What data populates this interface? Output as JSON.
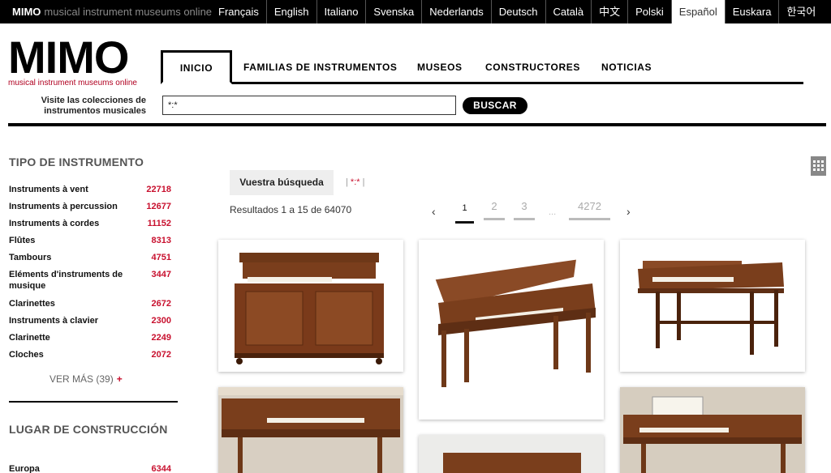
{
  "topbar": {
    "brand_short": "MIMO",
    "brand_long": "musical instrument museums online",
    "languages": [
      "Français",
      "English",
      "Italiano",
      "Svenska",
      "Nederlands",
      "Deutsch",
      "Català",
      "中文",
      "Polski",
      "Español",
      "Euskara",
      "한국어"
    ],
    "active_language": "Español"
  },
  "header": {
    "logo_word": "MIMO",
    "logo_sub": "musical instrument museums online",
    "tagline": "Visite las colecciones de instrumentos musicales",
    "nav": [
      "INICIO",
      "FAMILIAS DE INSTRUMENTOS",
      "MUSEOS",
      "CONSTRUCTORES",
      "NOTICIAS"
    ],
    "search_value": "*:*",
    "search_button": "BUSCAR"
  },
  "sidebar": {
    "instrument_type_title": "TIPO DE INSTRUMENTO",
    "facets": [
      {
        "label": "Instruments à vent",
        "count": "22718"
      },
      {
        "label": "Instruments à percussion",
        "count": "12677"
      },
      {
        "label": "Instruments à cordes",
        "count": "11152"
      },
      {
        "label": "Flûtes",
        "count": "8313"
      },
      {
        "label": "Tambours",
        "count": "4751"
      },
      {
        "label": "Eléments d'instruments de musique",
        "count": "3447"
      },
      {
        "label": "Clarinettes",
        "count": "2672"
      },
      {
        "label": "Instruments à clavier",
        "count": "2300"
      },
      {
        "label": "Clarinette",
        "count": "2249"
      },
      {
        "label": "Cloches",
        "count": "2072"
      }
    ],
    "see_more": "VER MÁS (39)",
    "see_more_plus": "+",
    "place_title": "LUGAR DE CONSTRUCCIÓN",
    "place_facets": [
      {
        "label": "Europa",
        "count": "6344"
      }
    ]
  },
  "main": {
    "query_chip": "Vuestra búsqueda",
    "query_term": "*:*",
    "results_text": "Resultados 1 a 15 de 64070",
    "pager": {
      "prev": "‹",
      "next": "›",
      "pages": [
        "1",
        "2",
        "3",
        "4272"
      ],
      "ellipsis": "...",
      "current": "1"
    },
    "grid_toggle_icon": "grid-icon"
  },
  "colors": {
    "accent_red": "#c8102e",
    "wood": "#8a4a26",
    "wood_dark": "#5e2e14",
    "wood_light": "#b0693c"
  }
}
